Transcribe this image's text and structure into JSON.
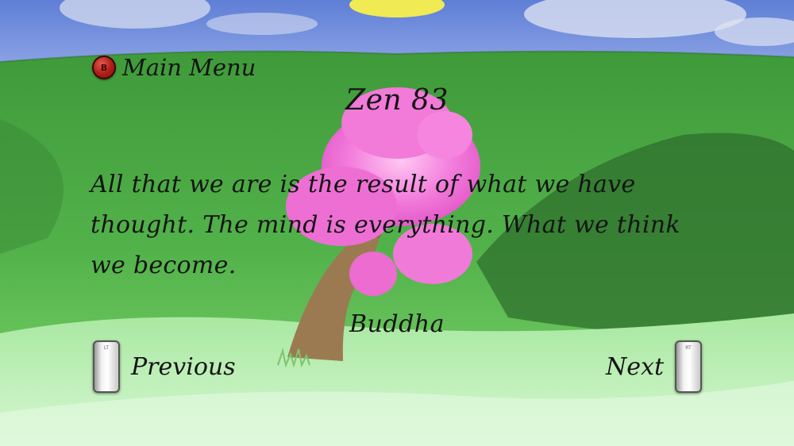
{
  "menu": {
    "button_glyph": "B",
    "label": "Main Menu"
  },
  "zen": {
    "title": "Zen 83",
    "quote": "All that we are is the result of what we have thought. The mind is everything. What we think we become.",
    "author": "Buddha"
  },
  "navigation": {
    "previous_trigger": "LT",
    "previous_label": "Previous",
    "next_label": "Next",
    "next_trigger": "RT"
  },
  "colors": {
    "sky": "#6f8fdc",
    "grass_dark": "#2f7d2f",
    "grass_light": "#7fd86a",
    "meadow": "#c9f2c6",
    "blossom": "#f27ad8",
    "trunk": "#9b7a52",
    "b_button": "#b3201a"
  },
  "icons": {
    "menu_button": "b-button-icon",
    "previous": "lt-trigger-icon",
    "next": "rt-trigger-icon"
  }
}
